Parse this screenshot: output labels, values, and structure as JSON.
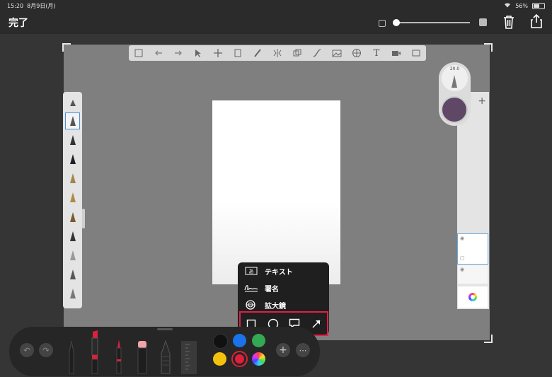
{
  "status": {
    "time": "15:20",
    "date": "8月9日(月)",
    "battery": "56%"
  },
  "header": {
    "done_label": "完了"
  },
  "brush_size": {
    "value": "20.0"
  },
  "current_color": "#5e4866",
  "menu": {
    "items": [
      {
        "icon": "text-box-icon",
        "label": "テキスト"
      },
      {
        "icon": "signature-icon",
        "label": "署名"
      },
      {
        "icon": "magnifier-icon",
        "label": "拡大鏡"
      }
    ],
    "shapes": [
      "square-shape-icon",
      "circle-shape-icon",
      "speech-bubble-icon",
      "arrow-icon"
    ],
    "highlight_color": "#e0204a"
  },
  "palette": {
    "colors": [
      "#111111",
      "#1a73e8",
      "#34a853",
      "#f4c20d",
      "#e0203a"
    ],
    "selected": "#e0203a"
  },
  "toolbar": {
    "tools": [
      "gallery-icon",
      "undo-icon",
      "redo-icon",
      "select-icon",
      "move-icon",
      "transform-icon",
      "brush-icon",
      "symmetry-icon",
      "fill-icon",
      "curve-icon",
      "image-icon",
      "grid-icon",
      "text-icon",
      "video-icon",
      "hide-icon"
    ],
    "text_tool_glyph": "T"
  }
}
